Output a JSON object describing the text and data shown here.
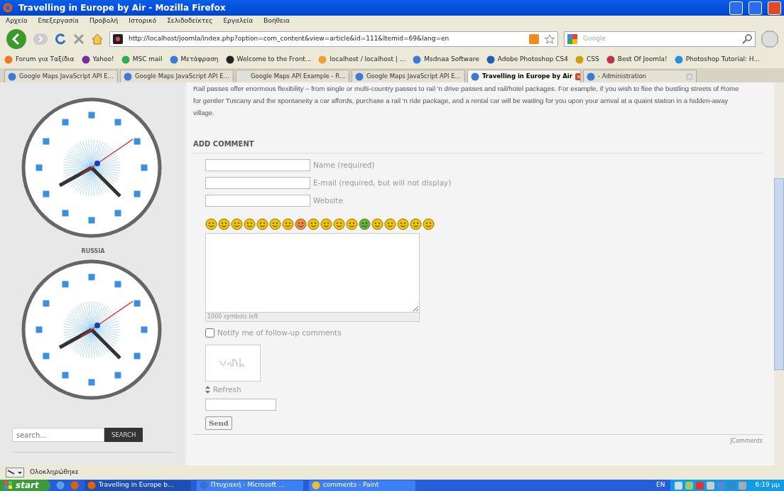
{
  "window": {
    "title": "Travelling in Europe by Air - Mozilla Firefox"
  },
  "menu": [
    "Αρχείο",
    "Επεξεργασία",
    "Προβολή",
    "Ιστορικό",
    "Σελιδοδείκτες",
    "Εργαλεία",
    "Βοήθεια"
  ],
  "address_bar": {
    "value": "http://localhost/joomla/index.php?option=com_content&view=article&id=111&Itemid=69&lang=en"
  },
  "search_bar": {
    "placeholder": "Google"
  },
  "bookmarks": [
    "Forum για Ταξίδια",
    "Yahoo!",
    "MSC mail",
    "Μετάφραση",
    "Welcome to the Front...",
    "localhost / localhost | ...",
    "Msdnaa Software",
    "Adobe Photoshop CS4",
    "CSS",
    "Best Of Joomla!",
    "Photoshop Tutorial: H..."
  ],
  "tabs": [
    {
      "label": "Google Maps JavaScript API E...",
      "selected": false
    },
    {
      "label": "Google Maps JavaScript API E...",
      "selected": false
    },
    {
      "label": "Google Maps API Example - R...",
      "selected": false
    },
    {
      "label": "Google Maps JavaScript API E...",
      "selected": false
    },
    {
      "label": "Travelling in Europe by Air",
      "selected": true
    },
    {
      "label": "- Administration",
      "selected": false
    }
  ],
  "sidebar": {
    "clocks": [
      {
        "label": "RUSSIA"
      }
    ],
    "search": {
      "placeholder": "search...",
      "button": "SEARCH"
    }
  },
  "article": {
    "paragraph": "Rail passes offer enormous flexibility – from single or multi-country passes to rail 'n drive passes and rail/hotel packages. For example, if you wish to flee the bustling streets of Rome for gentler Tuscany and the spontaneity a car affords, purchase a rail 'n ride package, and a rental car will be waiting for you upon your arrival at a quaint station in a hidden-away village."
  },
  "comment_form": {
    "heading": "ADD COMMENT",
    "fields": [
      {
        "label": "Name (required)"
      },
      {
        "label": "E-mail (required, but will not display)"
      },
      {
        "label": "Website"
      }
    ],
    "counter": "1000 symbols left",
    "notify": {
      "label": "Notify me of follow-up comments",
      "checked": false
    },
    "refresh": "Refresh",
    "send": "Send",
    "footer": "JComments"
  },
  "status_bar": {
    "text": "Ολοκληρώθηκε"
  },
  "taskbar": {
    "start": "start",
    "tasks": [
      {
        "label": "Travelling in Europe b...",
        "selected": true
      },
      {
        "label": "Πτυχιακή - Microsoft ...",
        "selected": false
      },
      {
        "label": "comments - Paint",
        "selected": false
      }
    ],
    "language": "EN",
    "clock": "6:19 μμ"
  }
}
